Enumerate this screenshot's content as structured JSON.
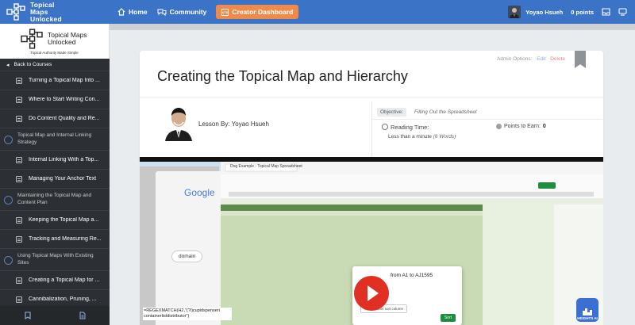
{
  "topbar": {
    "logo_text": "Topical Maps Unlocked",
    "nav": [
      {
        "label": "Home",
        "icon": "home-icon"
      },
      {
        "label": "Community",
        "icon": "community-icon"
      }
    ],
    "cta_label": "Creator Dashboard",
    "user_name": "Yoyao Hsueh",
    "points": "0 points",
    "accent": "#3b73c6",
    "cta_color": "#f08a4b"
  },
  "sidebar": {
    "brand_title": "Topical Maps Unlocked",
    "brand_tagline": "Topical Authority Made Simple",
    "back_label": "Back to Courses",
    "entries": [
      {
        "kind": "lesson",
        "label": "Turning a Topical Map Into ..."
      },
      {
        "kind": "lesson",
        "label": "Where to Start Writing Con..."
      },
      {
        "kind": "lesson",
        "label": "Do Content Quality and Re..."
      },
      {
        "kind": "topic",
        "label": "Topical Map and Internal Linking Strategy"
      },
      {
        "kind": "lesson",
        "label": "Internal Linking With a Top..."
      },
      {
        "kind": "lesson",
        "label": "Managing Your Anchor Text"
      },
      {
        "kind": "topic",
        "label": "Maintaining the Topical Map and Content Plan"
      },
      {
        "kind": "lesson",
        "label": "Keeping the Topical Map a..."
      },
      {
        "kind": "lesson",
        "label": "Tracking and Measuring Re..."
      },
      {
        "kind": "topic",
        "label": "Using Topical Maps With Existing Sites"
      },
      {
        "kind": "lesson",
        "label": "Creating a Topical Map for ..."
      },
      {
        "kind": "lesson",
        "label": "Cannibalization, Pruning, ..."
      }
    ]
  },
  "lesson": {
    "admin_label": "Admin Options:",
    "edit_label": "Edit",
    "delete_label": "Delete",
    "title": "Creating the Topical Map and Hierarchy",
    "author_line": "Lesson By: Yoyao Hsueh",
    "objective_label": "Objective:",
    "objective_value": "Filling Out the Spreadsheet",
    "reading_time_label": "Reading Time:",
    "reading_time_value": "Less than a minute",
    "reading_time_words": "(6 Words)",
    "points_label": "Points to Earn:",
    "points_value": "0"
  },
  "video": {
    "google_logo": "Google",
    "search_chip": "domain",
    "sheet_title": "Dog Example - Topical Map Spreadsheet",
    "sort_dialog_title": "from A1 to AJ1595",
    "sort_dialog_add": "Add another sort column",
    "sort_dialog_btn": "Sort",
    "formula_text": "=REGEXMATCH(H2,\"(?i)cupidspenseri containerlistdistributor\")"
  },
  "widget": {
    "label": "HEIGHTS AI"
  }
}
